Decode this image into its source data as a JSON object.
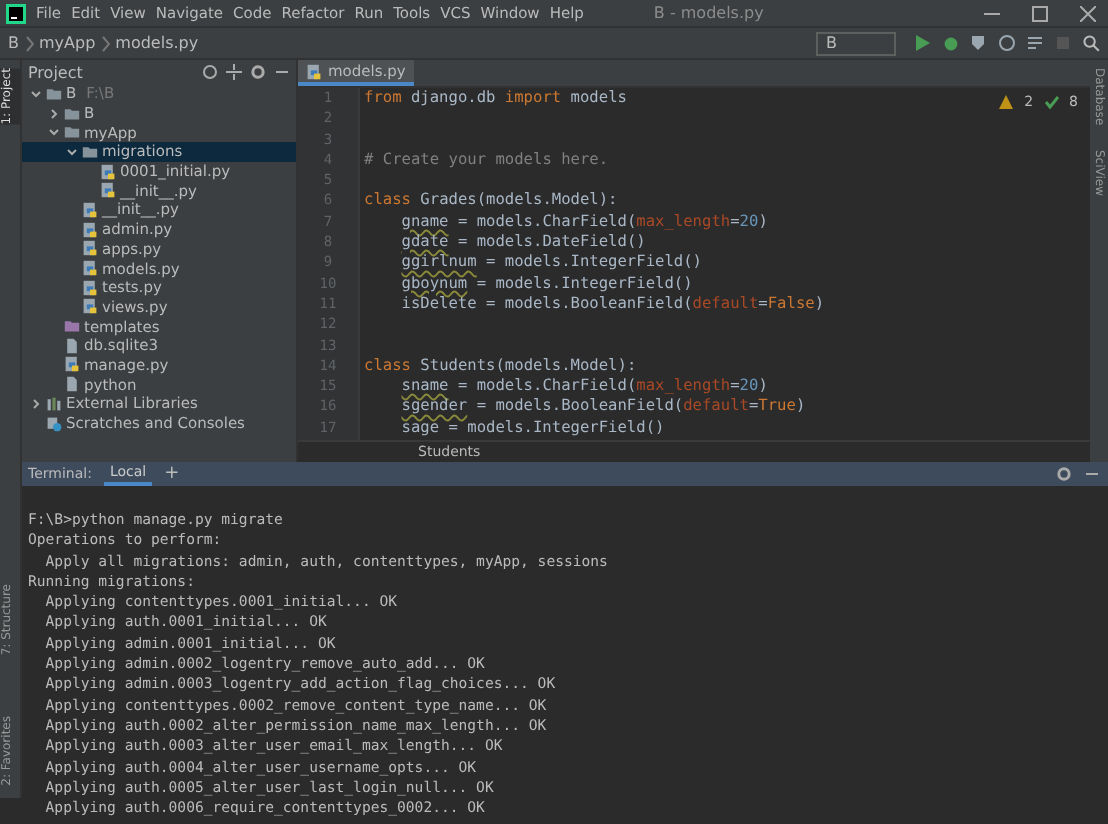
{
  "window": {
    "title": "B - models.py",
    "menu": [
      "File",
      "Edit",
      "View",
      "Navigate",
      "Code",
      "Refactor",
      "Run",
      "Tools",
      "VCS",
      "Window",
      "Help"
    ]
  },
  "navbar": {
    "breadcrumbs": [
      "B",
      "myApp",
      "models.py"
    ],
    "run_config": "B"
  },
  "left_strip": [
    {
      "label": "1: Project",
      "selected": true
    },
    {
      "label": "7: Structure",
      "selected": false
    },
    {
      "label": "2: Favorites",
      "selected": false
    }
  ],
  "right_strip": [
    {
      "label": "Database"
    },
    {
      "label": "SciView"
    }
  ],
  "project": {
    "title": "Project",
    "tree": [
      {
        "label": "B",
        "note": "F:\\B",
        "kind": "folder",
        "expanded": true,
        "selected": false,
        "children": [
          {
            "label": "B",
            "kind": "folder",
            "expanded": false,
            "selected": false
          },
          {
            "label": "myApp",
            "kind": "folder",
            "expanded": true,
            "selected": false,
            "children": [
              {
                "label": "migrations",
                "kind": "folder",
                "expanded": true,
                "selected": true,
                "children": [
                  {
                    "label": "0001_initial.py",
                    "kind": "python",
                    "selected": false
                  },
                  {
                    "label": "__init__.py",
                    "kind": "python",
                    "selected": false
                  }
                ]
              },
              {
                "label": "__init__.py",
                "kind": "python",
                "selected": false
              },
              {
                "label": "admin.py",
                "kind": "python",
                "selected": false
              },
              {
                "label": "apps.py",
                "kind": "python",
                "selected": false
              },
              {
                "label": "models.py",
                "kind": "python",
                "selected": false
              },
              {
                "label": "tests.py",
                "kind": "python",
                "selected": false
              },
              {
                "label": "views.py",
                "kind": "python",
                "selected": false
              }
            ]
          },
          {
            "label": "templates",
            "kind": "template-folder",
            "selected": false
          },
          {
            "label": "db.sqlite3",
            "kind": "file",
            "selected": false
          },
          {
            "label": "manage.py",
            "kind": "python",
            "selected": false
          },
          {
            "label": "python",
            "kind": "file",
            "selected": false
          }
        ]
      },
      {
        "label": "External Libraries",
        "kind": "library",
        "expanded": false,
        "selected": false
      },
      {
        "label": "Scratches and Consoles",
        "kind": "scratch",
        "selected": false
      }
    ]
  },
  "editor": {
    "tabs": [
      {
        "label": "models.py",
        "selected": true
      }
    ],
    "warnings": "2",
    "checks": "8",
    "breadcrumb": "Students",
    "lines": [
      {
        "number": "1",
        "tokens": [
          {
            "kind": "keyword",
            "text": "from"
          },
          {
            "kind": "plain",
            "text": " django.db "
          },
          {
            "kind": "keyword",
            "text": "import"
          },
          {
            "kind": "plain",
            "text": " models"
          }
        ]
      },
      {
        "number": "2"
      },
      {
        "number": "3"
      },
      {
        "number": "4",
        "tokens": [
          {
            "kind": "comment",
            "text": "# Create your models here."
          }
        ]
      },
      {
        "number": "5"
      },
      {
        "number": "6",
        "tokens": [
          {
            "kind": "keyword",
            "text": "class"
          },
          {
            "kind": "plain",
            "text": " Grades(models.Model):"
          }
        ]
      },
      {
        "number": "7",
        "indent": true,
        "tokens": [
          {
            "kind": "warn",
            "text": "gname"
          },
          {
            "kind": "plain",
            "text": " = models.CharField("
          },
          {
            "kind": "param",
            "text": "max_length"
          },
          {
            "kind": "plain",
            "text": "="
          },
          {
            "kind": "number",
            "text": "20"
          },
          {
            "kind": "plain",
            "text": ")"
          }
        ]
      },
      {
        "number": "8",
        "indent": true,
        "tokens": [
          {
            "kind": "warn",
            "text": "gdate"
          },
          {
            "kind": "plain",
            "text": " = models.DateField()"
          }
        ]
      },
      {
        "number": "9",
        "indent": true,
        "tokens": [
          {
            "kind": "warn",
            "text": "ggirlnum"
          },
          {
            "kind": "plain",
            "text": " = models.IntegerField()"
          }
        ]
      },
      {
        "number": "10",
        "indent": true,
        "tokens": [
          {
            "kind": "warn",
            "text": "gboynum"
          },
          {
            "kind": "plain",
            "text": " = models.IntegerField()"
          }
        ]
      },
      {
        "number": "11",
        "indent": true,
        "tokens": [
          {
            "kind": "plain",
            "text": "isDelete = models.BooleanField("
          },
          {
            "kind": "param",
            "text": "default"
          },
          {
            "kind": "plain",
            "text": "="
          },
          {
            "kind": "keyword",
            "text": "False"
          },
          {
            "kind": "plain",
            "text": ")"
          }
        ]
      },
      {
        "number": "12"
      },
      {
        "number": "13"
      },
      {
        "number": "14",
        "tokens": [
          {
            "kind": "keyword",
            "text": "class"
          },
          {
            "kind": "plain",
            "text": " Students(models.Model):"
          }
        ]
      },
      {
        "number": "15",
        "indent": true,
        "tokens": [
          {
            "kind": "warn",
            "text": "sname"
          },
          {
            "kind": "plain",
            "text": " = models.CharField("
          },
          {
            "kind": "param",
            "text": "max_length"
          },
          {
            "kind": "plain",
            "text": "="
          },
          {
            "kind": "number",
            "text": "20"
          },
          {
            "kind": "plain",
            "text": ")"
          }
        ]
      },
      {
        "number": "16",
        "indent": true,
        "tokens": [
          {
            "kind": "warn",
            "text": "sgender"
          },
          {
            "kind": "plain",
            "text": " = models.BooleanField("
          },
          {
            "kind": "param",
            "text": "default"
          },
          {
            "kind": "plain",
            "text": "="
          },
          {
            "kind": "keyword",
            "text": "True"
          },
          {
            "kind": "plain",
            "text": ")"
          }
        ]
      },
      {
        "number": "17",
        "indent": true,
        "tokens": [
          {
            "kind": "plain",
            "text": "sage = models.IntegerField()"
          }
        ]
      }
    ]
  },
  "terminal": {
    "title": "Terminal:",
    "tabs": [
      {
        "label": "Local",
        "selected": true
      }
    ],
    "add": "+",
    "lines": [
      "F:\\B>python manage.py migrate",
      "Operations to perform:",
      "  Apply all migrations: admin, auth, contenttypes, myApp, sessions",
      "Running migrations:",
      "  Applying contenttypes.0001_initial... OK",
      "  Applying auth.0001_initial... OK",
      "  Applying admin.0001_initial... OK",
      "  Applying admin.0002_logentry_remove_auto_add... OK",
      "  Applying admin.0003_logentry_add_action_flag_choices... OK",
      "  Applying contenttypes.0002_remove_content_type_name... OK",
      "  Applying auth.0002_alter_permission_name_max_length... OK",
      "  Applying auth.0003_alter_user_email_max_length... OK",
      "  Applying auth.0004_alter_user_username_opts... OK",
      "  Applying auth.0005_alter_user_last_login_null... OK",
      "  Applying auth.0006_require_contenttypes_0002... OK"
    ]
  }
}
